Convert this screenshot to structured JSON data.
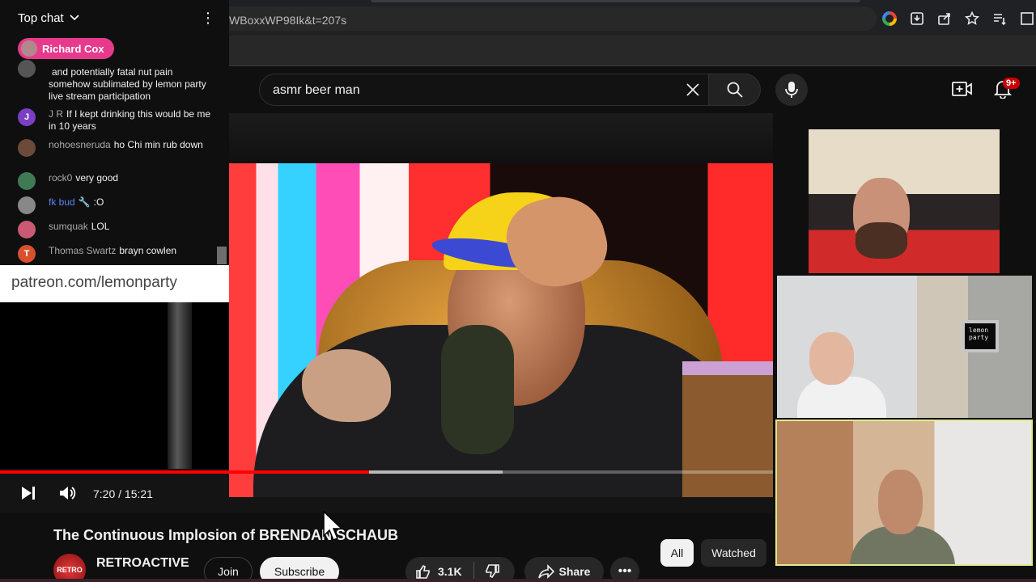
{
  "browser": {
    "url": "WBoxxWP98Ik&t=207s"
  },
  "header": {
    "search_value": "asmr beer man",
    "notification_badge": "9+"
  },
  "chat": {
    "title": "Top chat",
    "pinned_name": "Richard Cox",
    "messages": [
      {
        "author": "",
        "text": "and potentially fatal nut pain somehow sublimated by lemon party live stream participation",
        "avatar": "",
        "avatar_color": "#555555"
      },
      {
        "author": "J R",
        "text": "If I kept drinking this would be me in 10 years",
        "avatar": "J",
        "avatar_color": "#7b3fc4"
      },
      {
        "author": "nohoesneruda",
        "text": "ho Chi min rub down",
        "avatar": "",
        "avatar_color": "#6b4a3a"
      },
      {
        "author": "rock0",
        "text": "very good",
        "avatar": "",
        "avatar_color": "#3f7a55"
      },
      {
        "author": "fk bud",
        "text": ":O",
        "avatar": "",
        "avatar_color": "#888888",
        "moderator": true
      },
      {
        "author": "sumquak",
        "text": "LOL",
        "avatar": "",
        "avatar_color": "#c85a73"
      },
      {
        "author": "Thomas Swartz",
        "text": "brayn cowlen",
        "avatar": "T",
        "avatar_color": "#d9502f"
      }
    ]
  },
  "overlay": {
    "patreon": "patreon.com/lemonparty",
    "screen_text": "lemon party"
  },
  "player": {
    "time": "7:20 / 15:21",
    "progress": 0.478,
    "buffered": 0.65
  },
  "video": {
    "title": "The Continuous Implosion of BRENDAN SCHAUB",
    "channel": "RETROACTIVE",
    "channel_avatar_text": "RETRO",
    "join": "Join",
    "subscribe": "Subscribe",
    "likes": "3.1K",
    "share": "Share"
  },
  "chips": {
    "all": "All",
    "watched": "Watched"
  },
  "colors": {
    "accent_red": "#ff0000",
    "pinned_pink": "#e83a8d"
  }
}
